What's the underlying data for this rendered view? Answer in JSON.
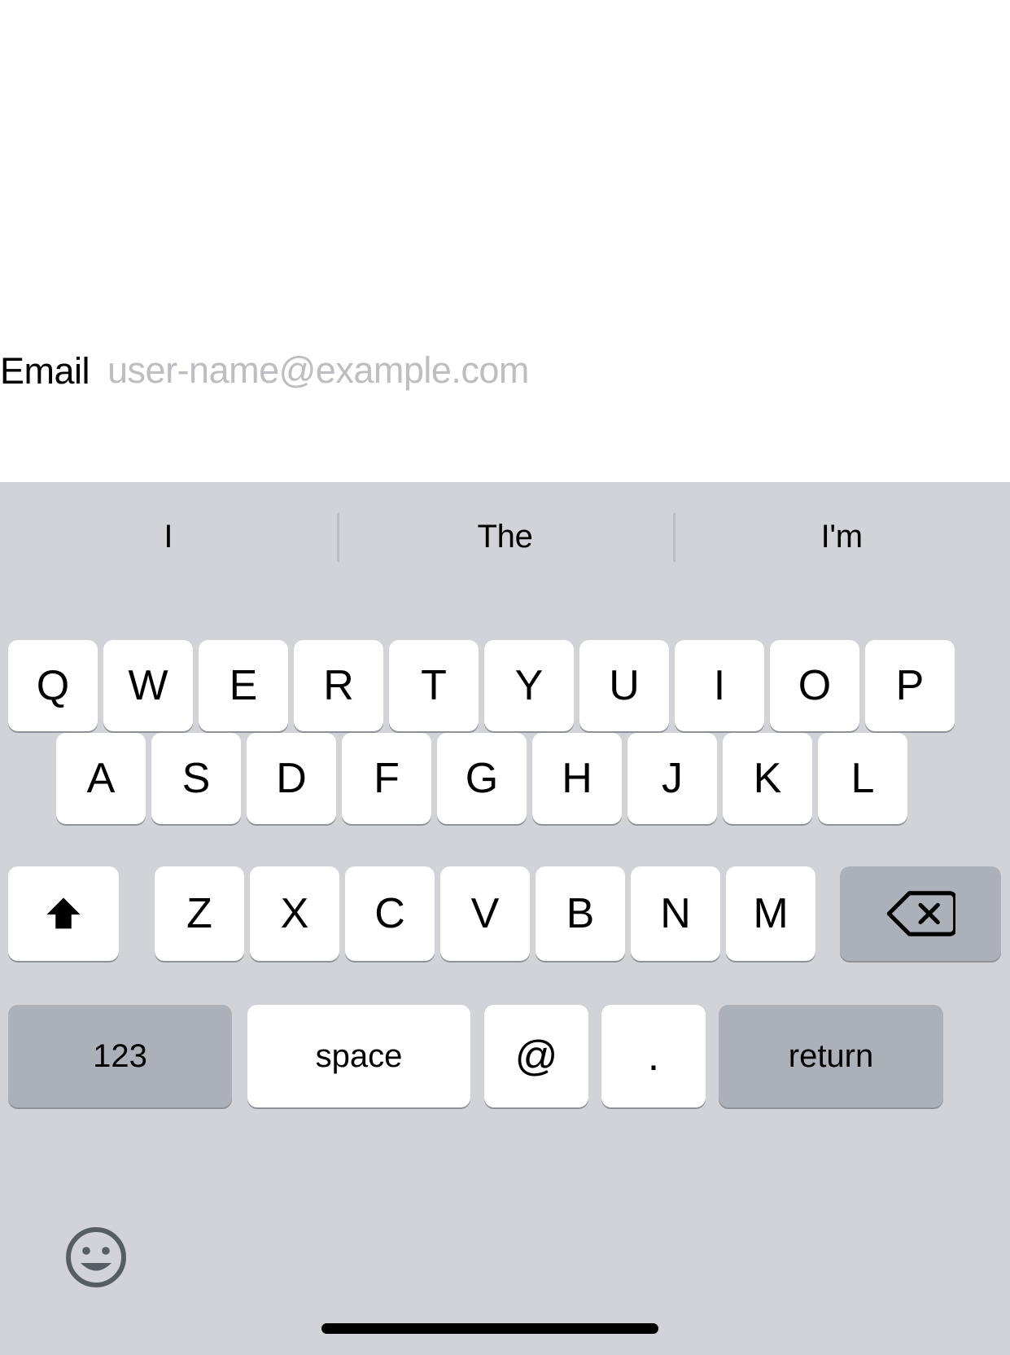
{
  "form": {
    "email_label": "Email",
    "email_value": "",
    "email_placeholder": "user-name@example.com"
  },
  "keyboard": {
    "predictions": [
      "I",
      "The",
      "I'm"
    ],
    "row1": [
      "Q",
      "W",
      "E",
      "R",
      "T",
      "Y",
      "U",
      "I",
      "O",
      "P"
    ],
    "row2": [
      "A",
      "S",
      "D",
      "F",
      "G",
      "H",
      "J",
      "K",
      "L"
    ],
    "row3_letters": [
      "Z",
      "X",
      "C",
      "V",
      "B",
      "N",
      "M"
    ],
    "shift_key": "shift-icon",
    "backspace_key": "backspace-icon",
    "numeric_key": "123",
    "space_key": "space",
    "at_key": "@",
    "period_key": ".",
    "return_key": "return",
    "emoji_key": "emoji-icon"
  },
  "colors": {
    "keyboard_background": "#D1D3D9",
    "key_background": "#FFFFFF",
    "modifier_key_background": "#ACB0B9",
    "placeholder_text": "#BEBEC2",
    "label_text": "#000000",
    "separator": "#BCBEC4",
    "emoji_icon": "#565E64",
    "home_indicator": "#000000"
  }
}
